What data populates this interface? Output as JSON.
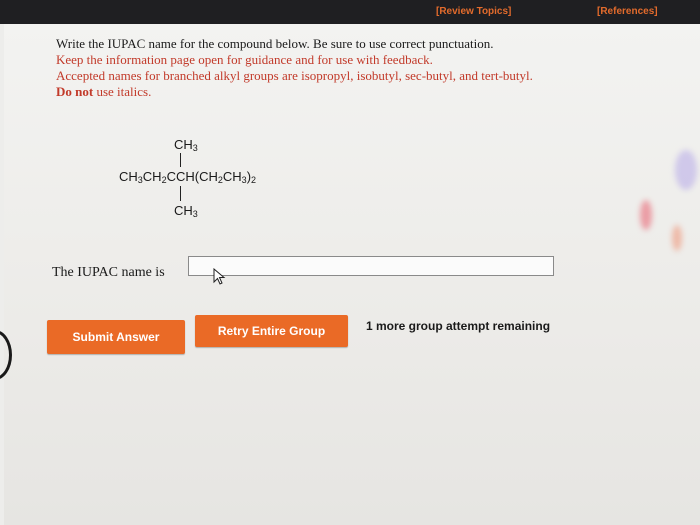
{
  "header": {
    "review_topics": "[Review Topics]",
    "references": "[References]"
  },
  "instructions": {
    "line1": "Write the IUPAC name for the compound below. Be sure to use correct punctuation.",
    "line2": "Keep the information page open for guidance and for use with feedback.",
    "line3": "Accepted names for branched alkyl groups are isopropyl, isobutyl, sec-butyl, and tert-butyl.",
    "line4_bold": "Do not",
    "line4_rest": " use italics."
  },
  "molecule": {
    "top_group": "CH3",
    "main_chain": "CH3CH2CCH(CH2CH3)2",
    "bottom_group": "CH3"
  },
  "question": {
    "label": "The IUPAC name is",
    "answer_value": "",
    "answer_placeholder": ""
  },
  "actions": {
    "submit_label": "Submit Answer",
    "retry_label": "Retry Entire Group",
    "attempts_text": "1 more group attempt remaining"
  },
  "colors": {
    "accent": "#ea6a26",
    "instruction_red": "#c23a2a",
    "header_bar": "#1f1f22"
  }
}
